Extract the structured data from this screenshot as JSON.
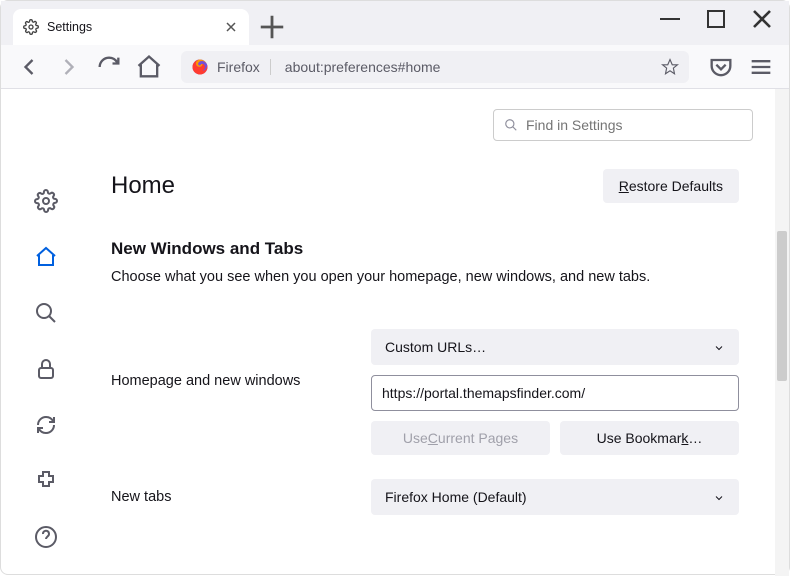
{
  "tab": {
    "title": "Settings"
  },
  "url": {
    "identity": "Firefox",
    "path": "about:preferences#home"
  },
  "search": {
    "placeholder": "Find in Settings"
  },
  "page": {
    "title": "Home",
    "restore": "Restore Defaults",
    "section_heading": "New Windows and Tabs",
    "section_desc": "Choose what you see when you open your homepage, new windows, and new tabs.",
    "homepage_label": "Homepage and new windows",
    "homepage_dropdown": "Custom URLs…",
    "homepage_url": "https://portal.themapsfinder.com/",
    "use_current_prefix": "Use ",
    "use_current_u": "C",
    "use_current_suffix": "urrent Pages",
    "use_bookmark_prefix": "Use Bookmar",
    "use_bookmark_u": "k",
    "use_bookmark_suffix": "…",
    "newtabs_label": "New tabs",
    "newtabs_dropdown": "Firefox Home (Default)"
  }
}
